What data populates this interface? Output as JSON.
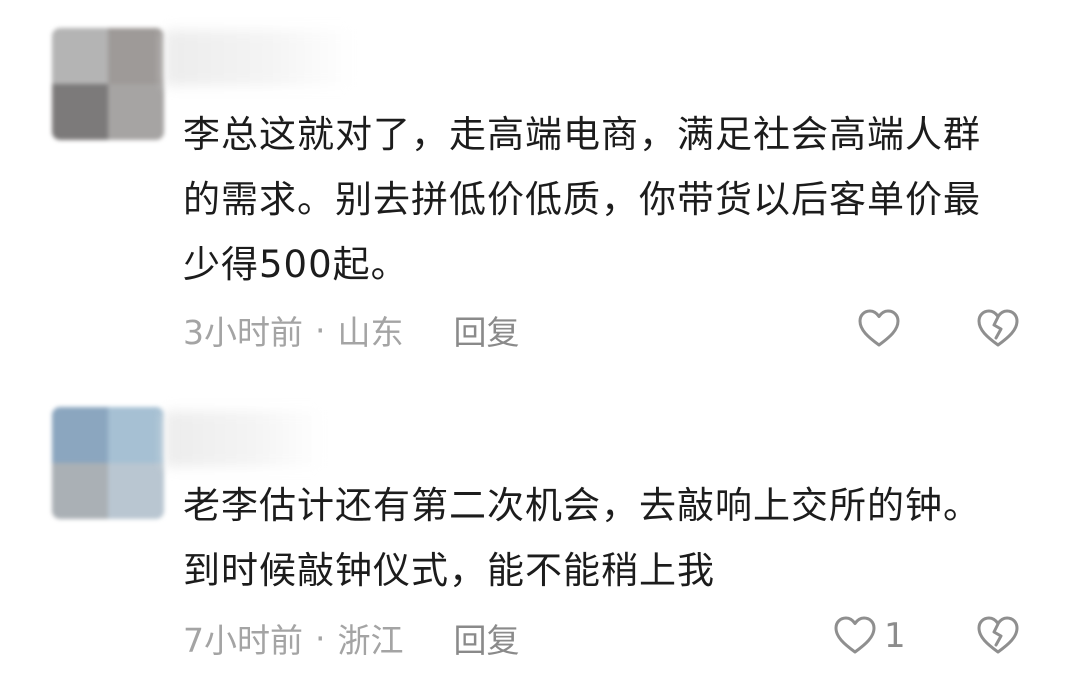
{
  "comments": [
    {
      "text": "李总这就对了，走高端电商，满足社会高端人群的需求。别去拼低价低质，你带货以后客单价最少得500起。",
      "time": "3小时前",
      "separator": "·",
      "location": "山东",
      "reply_label": "回复",
      "like_count": "",
      "like_icon": "heart-outline-icon",
      "dislike_icon": "broken-heart-icon",
      "avatar_colors": [
        "#b4b4b4",
        "#9e9a98",
        "#7c7a7a",
        "#a6a4a3"
      ]
    },
    {
      "text": "老李估计还有第二次机会，去敲响上交所的钟。到时候敲钟仪式，能不能稍上我",
      "time": "7小时前",
      "separator": "·",
      "location": "浙江",
      "reply_label": "回复",
      "like_count": "1",
      "like_icon": "heart-outline-icon",
      "dislike_icon": "broken-heart-icon",
      "avatar_colors": [
        "#8ba6bf",
        "#a6c0d3",
        "#aab0b5",
        "#b9c6d1"
      ]
    }
  ],
  "colors": {
    "text": "#1c1c1c",
    "meta": "#a4a4a4",
    "icon": "#8f8f8f"
  }
}
